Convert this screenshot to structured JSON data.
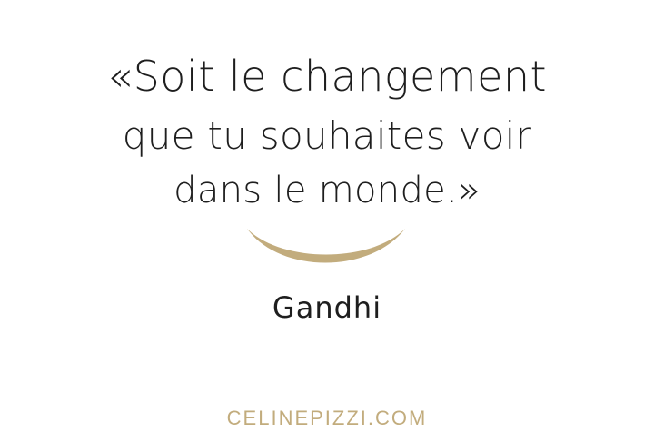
{
  "quote": {
    "line1": "«Soit le changement",
    "line2": "que tu souhaites voir",
    "line3": "dans le monde.»"
  },
  "author": "Gandhi",
  "website": "CELINEPIZZI.COM",
  "colors": {
    "text": "#1e1e1e",
    "accent": "#c2ac7d"
  },
  "decoration": "smile-swoosh-icon"
}
